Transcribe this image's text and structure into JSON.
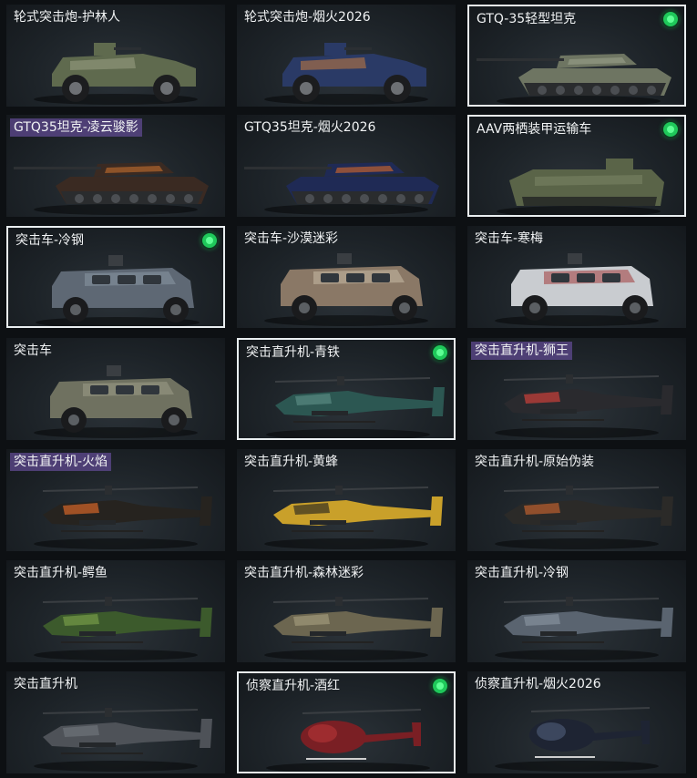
{
  "items": [
    {
      "label": "轮式突击炮-护林人",
      "kind": "armored-car",
      "main": "#5f6a4e",
      "accent": "#a2a68a",
      "tagged": false,
      "equipped": false,
      "selected": false
    },
    {
      "label": "轮式突击炮-烟火2026",
      "kind": "armored-car",
      "main": "#2a3a66",
      "accent": "#d5813a",
      "tagged": false,
      "equipped": false,
      "selected": false
    },
    {
      "label": "GTQ-35轻型坦克",
      "kind": "tank",
      "main": "#6e7562",
      "accent": "#9aa08a",
      "tagged": false,
      "equipped": true,
      "selected": true
    },
    {
      "label": "GTQ35坦克-凌云骏影",
      "kind": "tank",
      "main": "#3a2a22",
      "accent": "#c5702f",
      "tagged": true,
      "equipped": false,
      "selected": false
    },
    {
      "label": "GTQ35坦克-烟火2026",
      "kind": "tank",
      "main": "#1f2a55",
      "accent": "#d86a2a",
      "tagged": false,
      "equipped": false,
      "selected": false
    },
    {
      "label": "AAV两栖装甲运输车",
      "kind": "amphibious",
      "main": "#5a6448",
      "accent": "#7e8867",
      "tagged": false,
      "equipped": true,
      "selected": true
    },
    {
      "label": "突击车-冷钢",
      "kind": "assault-car",
      "main": "#5e6874",
      "accent": "#8a97a4",
      "tagged": false,
      "equipped": true,
      "selected": true
    },
    {
      "label": "突击车-沙漠迷彩",
      "kind": "assault-car",
      "main": "#8a7866",
      "accent": "#c9bba5",
      "tagged": false,
      "equipped": false,
      "selected": false
    },
    {
      "label": "突击车-寒梅",
      "kind": "assault-car",
      "main": "#c9ccd0",
      "accent": "#a03a3a",
      "tagged": false,
      "equipped": false,
      "selected": false
    },
    {
      "label": "突击车",
      "kind": "assault-car",
      "main": "#6f7160",
      "accent": "#9d9d88",
      "tagged": false,
      "equipped": false,
      "selected": false
    },
    {
      "label": "突击直升机-青铁",
      "kind": "attack-heli",
      "main": "#2c5752",
      "accent": "#5c8d86",
      "tagged": false,
      "equipped": true,
      "selected": true
    },
    {
      "label": "突击直升机-狮王",
      "kind": "attack-heli",
      "main": "#2a2a2e",
      "accent": "#d8423a",
      "tagged": true,
      "equipped": false,
      "selected": false
    },
    {
      "label": "突击直升机-火焰",
      "kind": "attack-heli",
      "main": "#26231f",
      "accent": "#e26a2a",
      "tagged": true,
      "equipped": false,
      "selected": false
    },
    {
      "label": "突击直升机-黄蜂",
      "kind": "attack-heli",
      "main": "#c9a02a",
      "accent": "#2a2620",
      "tagged": false,
      "equipped": false,
      "selected": false
    },
    {
      "label": "突击直升机-原始伪装",
      "kind": "attack-heli",
      "main": "#2b2a28",
      "accent": "#c8642e",
      "tagged": false,
      "equipped": false,
      "selected": false
    },
    {
      "label": "突击直升机-鳄鱼",
      "kind": "attack-heli",
      "main": "#3c5a2c",
      "accent": "#7aa04a",
      "tagged": false,
      "equipped": false,
      "selected": false
    },
    {
      "label": "突击直升机-森林迷彩",
      "kind": "attack-heli",
      "main": "#6c6650",
      "accent": "#a49c7c",
      "tagged": false,
      "equipped": false,
      "selected": false
    },
    {
      "label": "突击直升机-冷钢",
      "kind": "attack-heli",
      "main": "#5a6470",
      "accent": "#8894a0",
      "tagged": false,
      "equipped": false,
      "selected": false
    },
    {
      "label": "突击直升机",
      "kind": "attack-heli",
      "main": "#4e5258",
      "accent": "#70767c",
      "tagged": false,
      "equipped": false,
      "selected": false
    },
    {
      "label": "侦察直升机-酒红",
      "kind": "scout-heli",
      "main": "#7a1f24",
      "accent": "#c23a3a",
      "tagged": false,
      "equipped": true,
      "selected": true
    },
    {
      "label": "侦察直升机-烟火2026",
      "kind": "scout-heli",
      "main": "#1e2433",
      "accent": "#5a6a8a",
      "tagged": false,
      "equipped": false,
      "selected": false
    }
  ]
}
